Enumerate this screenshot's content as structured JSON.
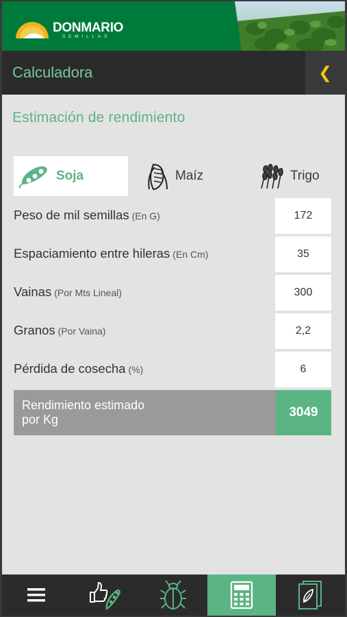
{
  "app": {
    "brand": "DONMARIO",
    "brand_sub": "SEMILLAS",
    "brand_color": "#007a3b",
    "accent": "#5bb483"
  },
  "titlebar": {
    "title": "Calculadora",
    "back_icon": "chevron-left-icon"
  },
  "section_title": "Estimación de rendimiento",
  "crops": [
    {
      "label": "Soja",
      "icon": "soybean-icon",
      "active": true
    },
    {
      "label": "Maíz",
      "icon": "corn-icon",
      "active": false
    },
    {
      "label": "Trigo",
      "icon": "wheat-icon",
      "active": false
    }
  ],
  "fields": [
    {
      "label": "Peso de mil semillas",
      "unit": "(En G)",
      "value": "172"
    },
    {
      "label": "Espaciamiento entre hileras",
      "unit": "(En Cm)",
      "value": "35"
    },
    {
      "label": "Vainas",
      "unit": "(Por Mts Lineal)",
      "value": "300"
    },
    {
      "label": "Granos",
      "unit": "(Por Vaina)",
      "value": "2,2"
    },
    {
      "label": "Pérdida de cosecha",
      "unit": "(%)",
      "value": "6"
    }
  ],
  "result": {
    "label_line1": "Rendimiento estimado",
    "label_line2": "por Kg",
    "value": "3049"
  },
  "nav": [
    {
      "icon": "menu-icon",
      "active": false
    },
    {
      "icon": "thumbs-up-soy-icon",
      "active": false
    },
    {
      "icon": "beetle-icon",
      "active": false
    },
    {
      "icon": "calculator-icon",
      "active": true
    },
    {
      "icon": "seed-catalog-icon",
      "active": false
    }
  ]
}
